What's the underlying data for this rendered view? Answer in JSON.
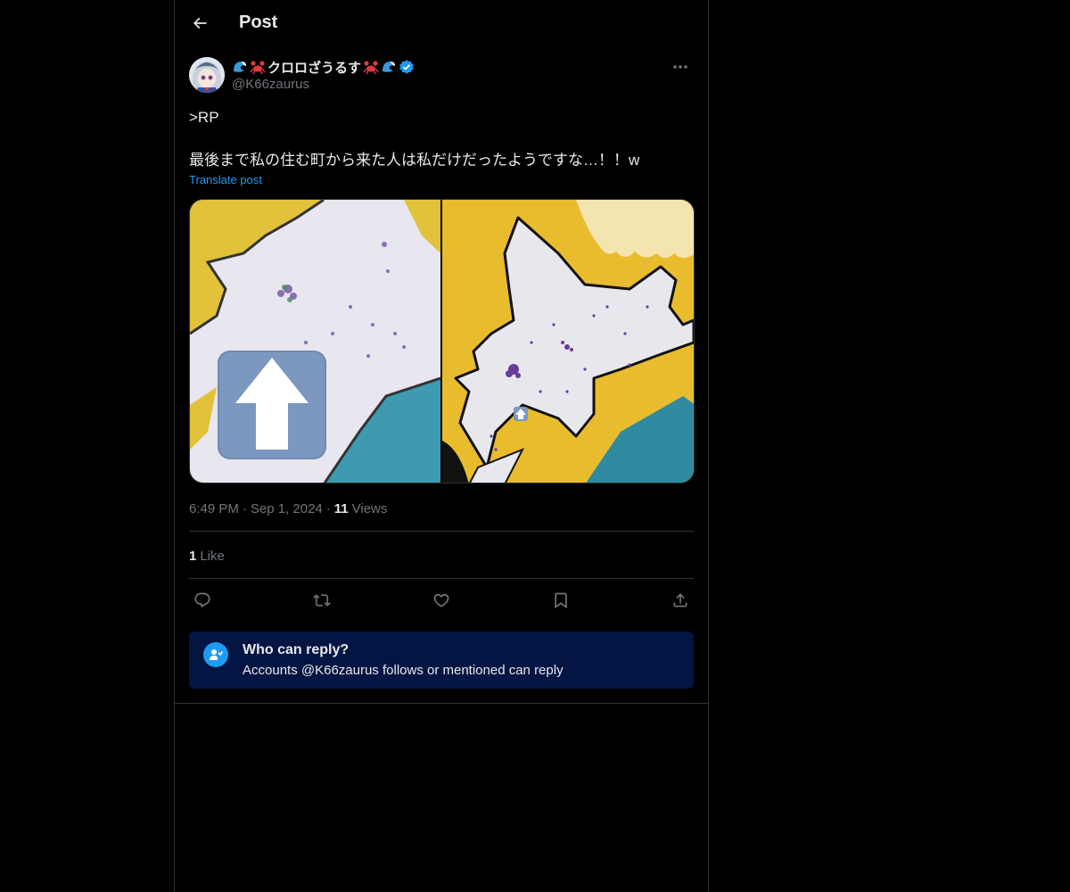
{
  "header": {
    "title": "Post"
  },
  "author": {
    "display_name": "クロロざうるす",
    "handle": "@K66zaurus",
    "verified": true
  },
  "post": {
    "line1": ">RP",
    "line2": "最後まで私の住む町から来た人は私だけだったようですな…！！w",
    "translate_label": "Translate post",
    "time": "6:49 PM",
    "date": "Sep 1, 2024",
    "views_count": "11",
    "views_label": "Views",
    "likes_count": "1",
    "likes_label": "Like"
  },
  "actions": {
    "icons": [
      "reply-icon",
      "repost-icon",
      "like-icon",
      "bookmark-icon",
      "share-icon"
    ]
  },
  "reply_restriction": {
    "title": "Who can reply?",
    "description": "Accounts @K66zaurus follows or mentioned can reply"
  },
  "colors": {
    "accent": "#1d9bf0",
    "background": "#000000",
    "border": "#2f3336",
    "muted_text": "#71767b",
    "reply_box_bg": "#031543"
  }
}
